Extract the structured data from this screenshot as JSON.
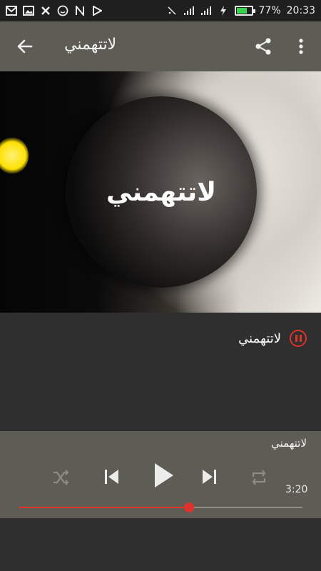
{
  "status_bar": {
    "battery_percent_label": "77%",
    "battery_level": 0.77,
    "time": "20:33",
    "left_icons": [
      "mail-icon",
      "image-icon",
      "x-icon",
      "emoji-icon",
      "n-icon",
      "play-store-icon"
    ],
    "right_icons": [
      "vibrate-icon",
      "signal-icon",
      "signal-icon",
      "charging-icon",
      "battery-icon"
    ]
  },
  "app_bar": {
    "title": "لاتتهمني",
    "actions": [
      "share-icon",
      "more-vert-icon"
    ]
  },
  "cover": {
    "label": "لاتتهمني"
  },
  "now_playing_list": {
    "track_name": "لاتتهمني",
    "state": "playing"
  },
  "player": {
    "now_title": "لاتتهمني",
    "duration": "3:20",
    "progress": 0.6,
    "controls": [
      "shuffle-icon",
      "skip-previous-icon",
      "play-icon",
      "skip-next-icon",
      "repeat-icon"
    ]
  },
  "colors": {
    "accent": "#e0322b",
    "appbar": "#5e5d55",
    "background": "#2f2f2f"
  }
}
